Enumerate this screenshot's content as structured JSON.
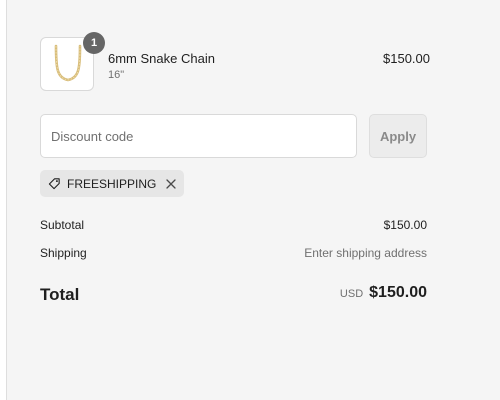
{
  "cart": {
    "item": {
      "name": "6mm Snake Chain",
      "variant": "16\"",
      "price": "$150.00",
      "quantity": "1",
      "image_icon": "gold-chain-necklace-icon"
    }
  },
  "discount": {
    "placeholder": "Discount code",
    "apply_label": "Apply",
    "applied_code": "FREESHIPPING"
  },
  "summary": {
    "subtotal_label": "Subtotal",
    "subtotal_value": "$150.00",
    "shipping_label": "Shipping",
    "shipping_value": "Enter shipping address",
    "total_label": "Total",
    "currency": "USD",
    "total_value": "$150.00"
  },
  "colors": {
    "panel_bg": "#f5f5f5",
    "badge_bg": "#666666",
    "tag_bg": "#e6e6e6",
    "chain_gold": "#d8bd7a"
  }
}
